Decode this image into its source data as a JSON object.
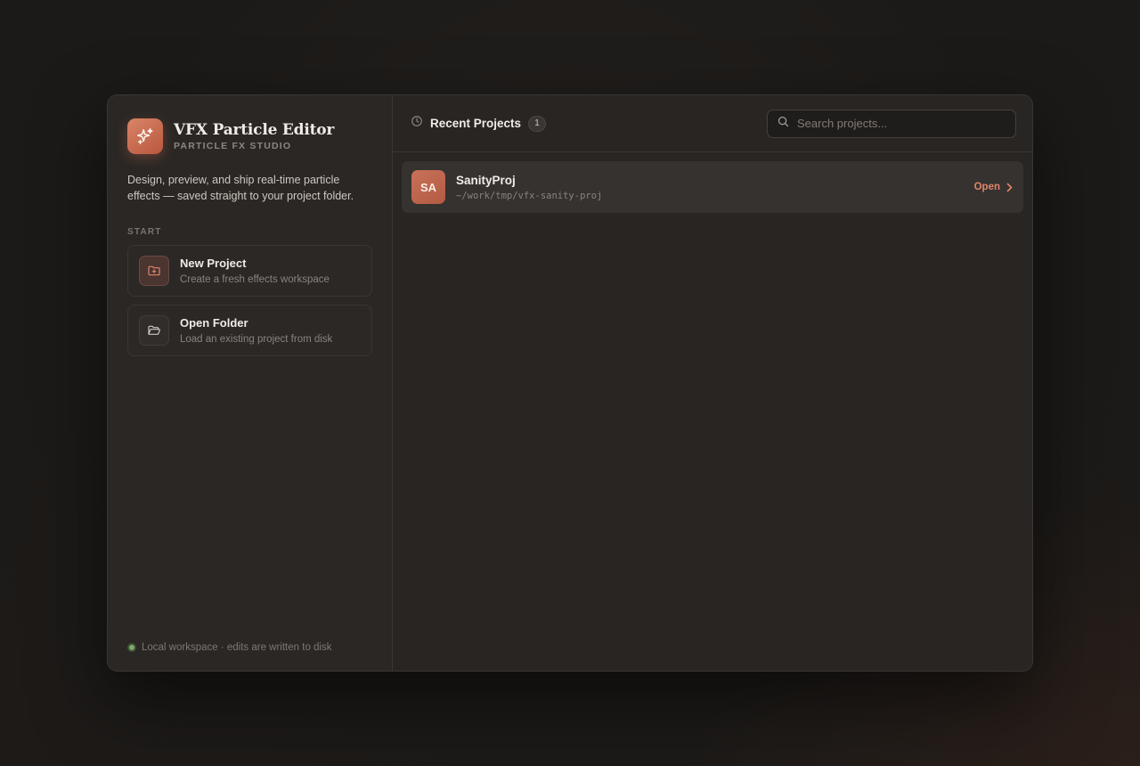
{
  "app": {
    "title": "VFX Particle Editor",
    "subtitle": "PARTICLE FX STUDIO",
    "tagline": "Design, preview, and ship real-time particle effects — saved straight to your project folder.",
    "logo_icon": "sparkles-icon",
    "accent_color": "#c9694f"
  },
  "sidebar": {
    "section_label": "START",
    "actions": [
      {
        "title": "New Project",
        "description": "Create a fresh effects workspace",
        "icon": "folder-plus-icon"
      },
      {
        "title": "Open Folder",
        "description": "Load an existing project from disk",
        "icon": "folder-open-icon"
      }
    ],
    "footer": {
      "status_text": "Local workspace · edits are written to disk",
      "status_color": "#7fa86a"
    }
  },
  "main": {
    "header": {
      "icon": "clock-icon",
      "title": "Recent Projects",
      "count": "1"
    },
    "search": {
      "placeholder": "Search projects...",
      "value": ""
    },
    "projects": [
      {
        "initials": "SA",
        "name": "SanityProj",
        "path": "~/work/tmp/vfx-sanity-proj",
        "action_label": "Open"
      }
    ]
  }
}
